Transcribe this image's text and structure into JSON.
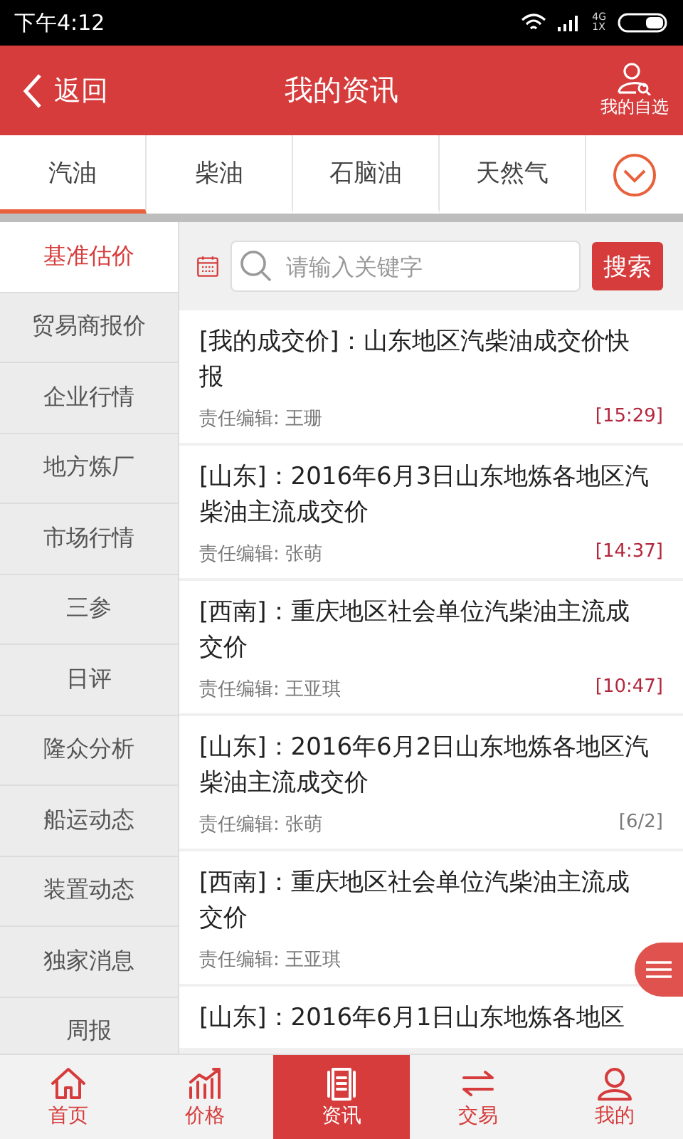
{
  "status_bar": {
    "time": "下午4:12",
    "network": "4G\n1X"
  },
  "header": {
    "back": "返回",
    "title": "我的资讯",
    "favorites": "我的自选"
  },
  "tabs": [
    {
      "label": "汽油",
      "selected": true
    },
    {
      "label": "柴油",
      "selected": false
    },
    {
      "label": "石脑油",
      "selected": false
    },
    {
      "label": "天然气",
      "selected": false
    }
  ],
  "sidebar": {
    "items": [
      {
        "label": "基准估价",
        "selected": true
      },
      {
        "label": "贸易商报价",
        "selected": false
      },
      {
        "label": "企业行情",
        "selected": false
      },
      {
        "label": "地方炼厂",
        "selected": false
      },
      {
        "label": "市场行情",
        "selected": false
      },
      {
        "label": "三参",
        "selected": false
      },
      {
        "label": "日评",
        "selected": false
      },
      {
        "label": "隆众分析",
        "selected": false
      },
      {
        "label": "船运动态",
        "selected": false
      },
      {
        "label": "装置动态",
        "selected": false
      },
      {
        "label": "独家消息",
        "selected": false
      },
      {
        "label": "周报",
        "selected": false
      }
    ]
  },
  "search": {
    "placeholder": "请输入关键字",
    "button": "搜索"
  },
  "articles": [
    {
      "title": "[我的成交价]：山东地区汽柴油成交价快报",
      "editor": "责任编辑: 王珊",
      "time": "[15:29]",
      "today": true
    },
    {
      "title": "[山东]：2016年6月3日山东地炼各地区汽柴油主流成交价",
      "editor": "责任编辑: 张萌",
      "time": "[14:37]",
      "today": true
    },
    {
      "title": "[西南]：重庆地区社会单位汽柴油主流成交价",
      "editor": "责任编辑: 王亚琪",
      "time": "[10:47]",
      "today": true
    },
    {
      "title": "[山东]：2016年6月2日山东地炼各地区汽柴油主流成交价",
      "editor": "责任编辑: 张萌",
      "time": "[6/2]",
      "today": false
    },
    {
      "title": "[西南]：重庆地区社会单位汽柴油主流成交价",
      "editor": "责任编辑: 王亚琪"
    },
    {
      "title": "[山东]：2016年6月1日山东地炼各地区"
    }
  ],
  "bottom_nav": [
    {
      "label": "首页",
      "selected": false
    },
    {
      "label": "价格",
      "selected": false
    },
    {
      "label": "资讯",
      "selected": true
    },
    {
      "label": "交易",
      "selected": false
    },
    {
      "label": "我的",
      "selected": false
    }
  ]
}
